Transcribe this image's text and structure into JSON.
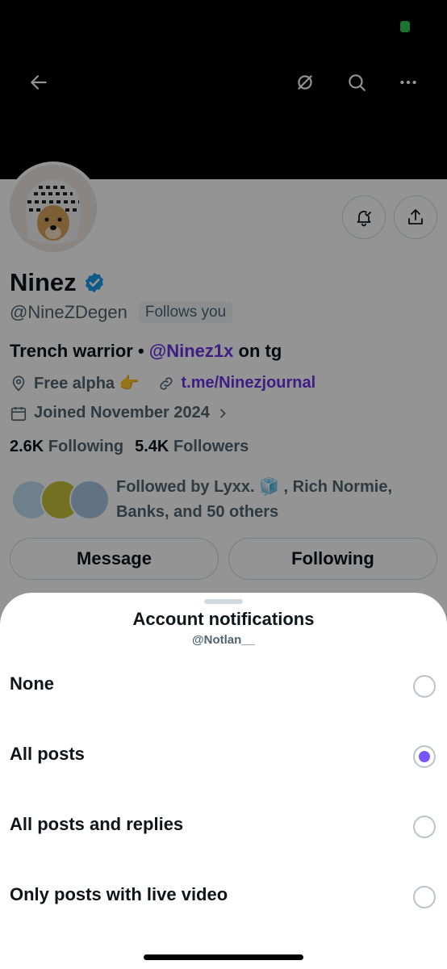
{
  "colors": {
    "accent": "#7856ff",
    "link": "#6b35e6",
    "verified": "#1d9bf0"
  },
  "nav": {
    "back_icon": "arrow-left-icon",
    "icons": [
      "crypto-icon",
      "search-icon",
      "more-icon"
    ]
  },
  "profile": {
    "name": "Ninez",
    "handle": "@NineZDegen",
    "follows_you": "Follows you",
    "bio_prefix": "Trench warrior •",
    "bio_mention": "@Ninez1x",
    "bio_suffix": "on tg",
    "location": "Free alpha 👉",
    "website": "t.me/Ninezjournal",
    "joined": "Joined November 2024",
    "following_count": "2.6K",
    "following_label": "Following",
    "followers_count": "5.4K",
    "followers_label": "Followers",
    "followed_by": "Followed by Lyxx. 🧊 , Rich Normie, Banks, and 50 others",
    "message_button": "Message",
    "following_button": "Following"
  },
  "sheet": {
    "title": "Account notifications",
    "subtitle": "@Notlan__",
    "options": [
      {
        "label": "None",
        "selected": false
      },
      {
        "label": "All posts",
        "selected": true
      },
      {
        "label": "All posts and replies",
        "selected": false
      },
      {
        "label": "Only posts with live video",
        "selected": false
      }
    ]
  }
}
